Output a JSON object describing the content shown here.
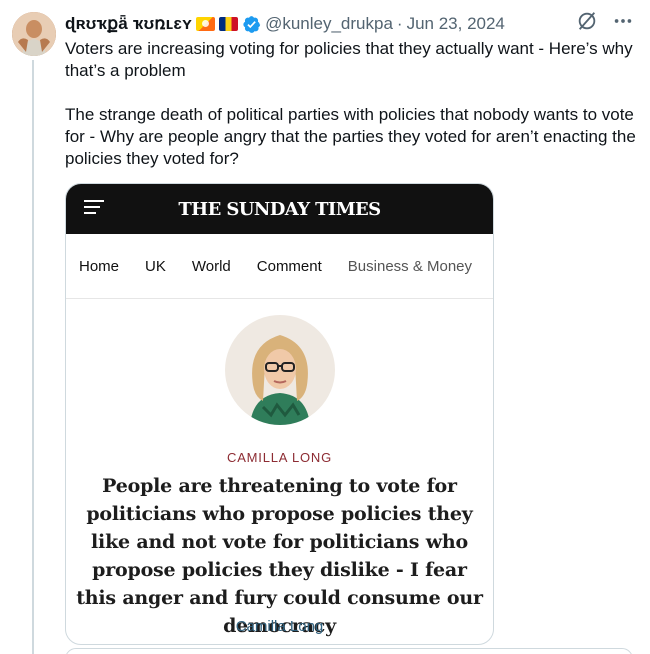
{
  "author": {
    "display_name": "ɖʀʊҡքǟ ҡʊռʟɛʏ",
    "handle": "@kunley_drukpa",
    "separator": "·",
    "date": "Jun 23, 2024"
  },
  "tweet": {
    "text": "Voters are increasing voting for policies that they actually want - Here’s why that’s a problem\n\nThe strange death of political parties with policies that nobody wants to vote for - Why are people angry that the parties they voted for aren’t enacting the policies they voted for?"
  },
  "card": {
    "masthead": "THE SUNDAY TIMES",
    "nav": [
      "Home",
      "UK",
      "World",
      "Comment",
      "Business & Money"
    ],
    "byline_caps": "CAMILLA LONG",
    "headline": "People are threatening to vote for politicians who propose policies they like and not vote for politicians who propose policies they dislike - I fear this anger and fury could consume our democracy",
    "byline_link": "Camilla Long"
  },
  "icons": {
    "flags": [
      "flag-bhutan-icon",
      "flag-romania-icon"
    ],
    "verified": "verified-badge-icon",
    "grok": "grok-icon",
    "more": "more-icon",
    "menu": "hamburger-menu-icon"
  },
  "colors": {
    "verified_blue": "#1d9bf0",
    "secondary_text": "#536471",
    "byline_red": "#8d2c33",
    "byline_link_blue": "#30617e"
  }
}
